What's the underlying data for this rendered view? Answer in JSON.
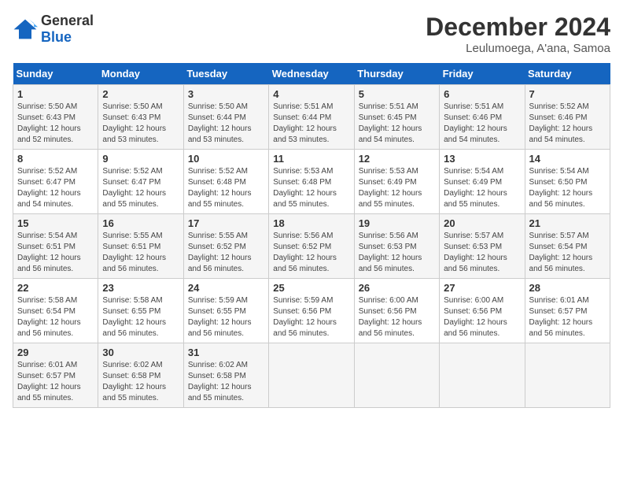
{
  "logo": {
    "general": "General",
    "blue": "Blue"
  },
  "title": "December 2024",
  "location": "Leulumoega, A'ana, Samoa",
  "days_of_week": [
    "Sunday",
    "Monday",
    "Tuesday",
    "Wednesday",
    "Thursday",
    "Friday",
    "Saturday"
  ],
  "weeks": [
    [
      {
        "day": "1",
        "sunrise": "5:50 AM",
        "sunset": "6:43 PM",
        "daylight": "12 hours and 52 minutes."
      },
      {
        "day": "2",
        "sunrise": "5:50 AM",
        "sunset": "6:43 PM",
        "daylight": "12 hours and 53 minutes."
      },
      {
        "day": "3",
        "sunrise": "5:50 AM",
        "sunset": "6:44 PM",
        "daylight": "12 hours and 53 minutes."
      },
      {
        "day": "4",
        "sunrise": "5:51 AM",
        "sunset": "6:44 PM",
        "daylight": "12 hours and 53 minutes."
      },
      {
        "day": "5",
        "sunrise": "5:51 AM",
        "sunset": "6:45 PM",
        "daylight": "12 hours and 54 minutes."
      },
      {
        "day": "6",
        "sunrise": "5:51 AM",
        "sunset": "6:46 PM",
        "daylight": "12 hours and 54 minutes."
      },
      {
        "day": "7",
        "sunrise": "5:52 AM",
        "sunset": "6:46 PM",
        "daylight": "12 hours and 54 minutes."
      }
    ],
    [
      {
        "day": "8",
        "sunrise": "5:52 AM",
        "sunset": "6:47 PM",
        "daylight": "12 hours and 54 minutes."
      },
      {
        "day": "9",
        "sunrise": "5:52 AM",
        "sunset": "6:47 PM",
        "daylight": "12 hours and 55 minutes."
      },
      {
        "day": "10",
        "sunrise": "5:52 AM",
        "sunset": "6:48 PM",
        "daylight": "12 hours and 55 minutes."
      },
      {
        "day": "11",
        "sunrise": "5:53 AM",
        "sunset": "6:48 PM",
        "daylight": "12 hours and 55 minutes."
      },
      {
        "day": "12",
        "sunrise": "5:53 AM",
        "sunset": "6:49 PM",
        "daylight": "12 hours and 55 minutes."
      },
      {
        "day": "13",
        "sunrise": "5:54 AM",
        "sunset": "6:49 PM",
        "daylight": "12 hours and 55 minutes."
      },
      {
        "day": "14",
        "sunrise": "5:54 AM",
        "sunset": "6:50 PM",
        "daylight": "12 hours and 56 minutes."
      }
    ],
    [
      {
        "day": "15",
        "sunrise": "5:54 AM",
        "sunset": "6:51 PM",
        "daylight": "12 hours and 56 minutes."
      },
      {
        "day": "16",
        "sunrise": "5:55 AM",
        "sunset": "6:51 PM",
        "daylight": "12 hours and 56 minutes."
      },
      {
        "day": "17",
        "sunrise": "5:55 AM",
        "sunset": "6:52 PM",
        "daylight": "12 hours and 56 minutes."
      },
      {
        "day": "18",
        "sunrise": "5:56 AM",
        "sunset": "6:52 PM",
        "daylight": "12 hours and 56 minutes."
      },
      {
        "day": "19",
        "sunrise": "5:56 AM",
        "sunset": "6:53 PM",
        "daylight": "12 hours and 56 minutes."
      },
      {
        "day": "20",
        "sunrise": "5:57 AM",
        "sunset": "6:53 PM",
        "daylight": "12 hours and 56 minutes."
      },
      {
        "day": "21",
        "sunrise": "5:57 AM",
        "sunset": "6:54 PM",
        "daylight": "12 hours and 56 minutes."
      }
    ],
    [
      {
        "day": "22",
        "sunrise": "5:58 AM",
        "sunset": "6:54 PM",
        "daylight": "12 hours and 56 minutes."
      },
      {
        "day": "23",
        "sunrise": "5:58 AM",
        "sunset": "6:55 PM",
        "daylight": "12 hours and 56 minutes."
      },
      {
        "day": "24",
        "sunrise": "5:59 AM",
        "sunset": "6:55 PM",
        "daylight": "12 hours and 56 minutes."
      },
      {
        "day": "25",
        "sunrise": "5:59 AM",
        "sunset": "6:56 PM",
        "daylight": "12 hours and 56 minutes."
      },
      {
        "day": "26",
        "sunrise": "6:00 AM",
        "sunset": "6:56 PM",
        "daylight": "12 hours and 56 minutes."
      },
      {
        "day": "27",
        "sunrise": "6:00 AM",
        "sunset": "6:56 PM",
        "daylight": "12 hours and 56 minutes."
      },
      {
        "day": "28",
        "sunrise": "6:01 AM",
        "sunset": "6:57 PM",
        "daylight": "12 hours and 56 minutes."
      }
    ],
    [
      {
        "day": "29",
        "sunrise": "6:01 AM",
        "sunset": "6:57 PM",
        "daylight": "12 hours and 55 minutes."
      },
      {
        "day": "30",
        "sunrise": "6:02 AM",
        "sunset": "6:58 PM",
        "daylight": "12 hours and 55 minutes."
      },
      {
        "day": "31",
        "sunrise": "6:02 AM",
        "sunset": "6:58 PM",
        "daylight": "12 hours and 55 minutes."
      },
      null,
      null,
      null,
      null
    ]
  ]
}
